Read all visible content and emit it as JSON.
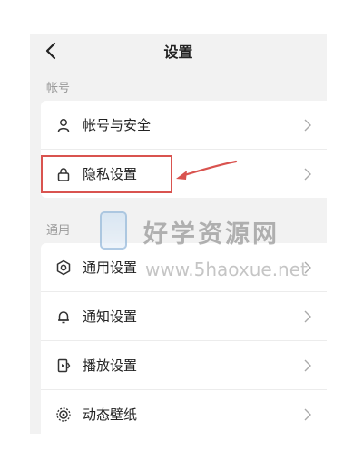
{
  "header": {
    "title": "设置",
    "back_icon": "chevron-left-icon"
  },
  "sections": [
    {
      "label": "帐号",
      "items": [
        {
          "label": "帐号与安全",
          "icon": "user-icon"
        },
        {
          "label": "隐私设置",
          "icon": "lock-icon"
        }
      ]
    },
    {
      "label": "通用",
      "items": [
        {
          "label": "通用设置",
          "icon": "gear-icon"
        },
        {
          "label": "通知设置",
          "icon": "bell-icon"
        },
        {
          "label": "播放设置",
          "icon": "play-icon"
        },
        {
          "label": "动态壁纸",
          "icon": "wallpaper-icon"
        }
      ]
    }
  ],
  "watermark": {
    "title": "好学资源网",
    "url": "www.5haoxue.net"
  },
  "annotation": {
    "highlight_color": "#d9534f"
  }
}
